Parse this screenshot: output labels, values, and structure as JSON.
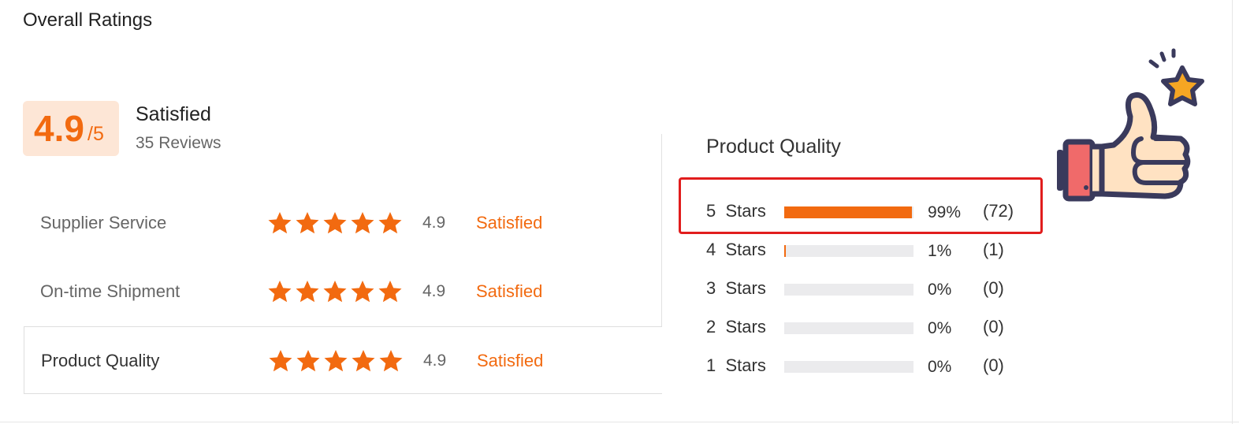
{
  "title": "Overall Ratings",
  "summary": {
    "score": "4.9",
    "max": "/5",
    "label": "Satisfied",
    "reviews": "35 Reviews"
  },
  "categories": [
    {
      "label": "Supplier Service",
      "score": "4.9",
      "status": "Satisfied",
      "stars": 5
    },
    {
      "label": "On-time Shipment",
      "score": "4.9",
      "status": "Satisfied",
      "stars": 5
    },
    {
      "label": "Product Quality",
      "score": "4.9",
      "status": "Satisfied",
      "stars": 5
    }
  ],
  "distribution": {
    "title": "Product Quality",
    "rows": [
      {
        "level": "5",
        "unit": "Stars",
        "percent_text": "99%",
        "count_text": "(72)",
        "fraction": 0.99
      },
      {
        "level": "4",
        "unit": "Stars",
        "percent_text": "1%",
        "count_text": "(1)",
        "fraction": 0.01
      },
      {
        "level": "3",
        "unit": "Stars",
        "percent_text": "0%",
        "count_text": "(0)",
        "fraction": 0
      },
      {
        "level": "2",
        "unit": "Stars",
        "percent_text": "0%",
        "count_text": "(0)",
        "fraction": 0
      },
      {
        "level": "1",
        "unit": "Stars",
        "percent_text": "0%",
        "count_text": "(0)",
        "fraction": 0
      }
    ]
  },
  "colors": {
    "accent": "#f26a10",
    "highlight": "#e11d1d",
    "track": "#ebebed",
    "score_bg": "#fde6d6"
  },
  "icons": {
    "star": "star-icon",
    "decoration": "thumbs-up-icon"
  }
}
